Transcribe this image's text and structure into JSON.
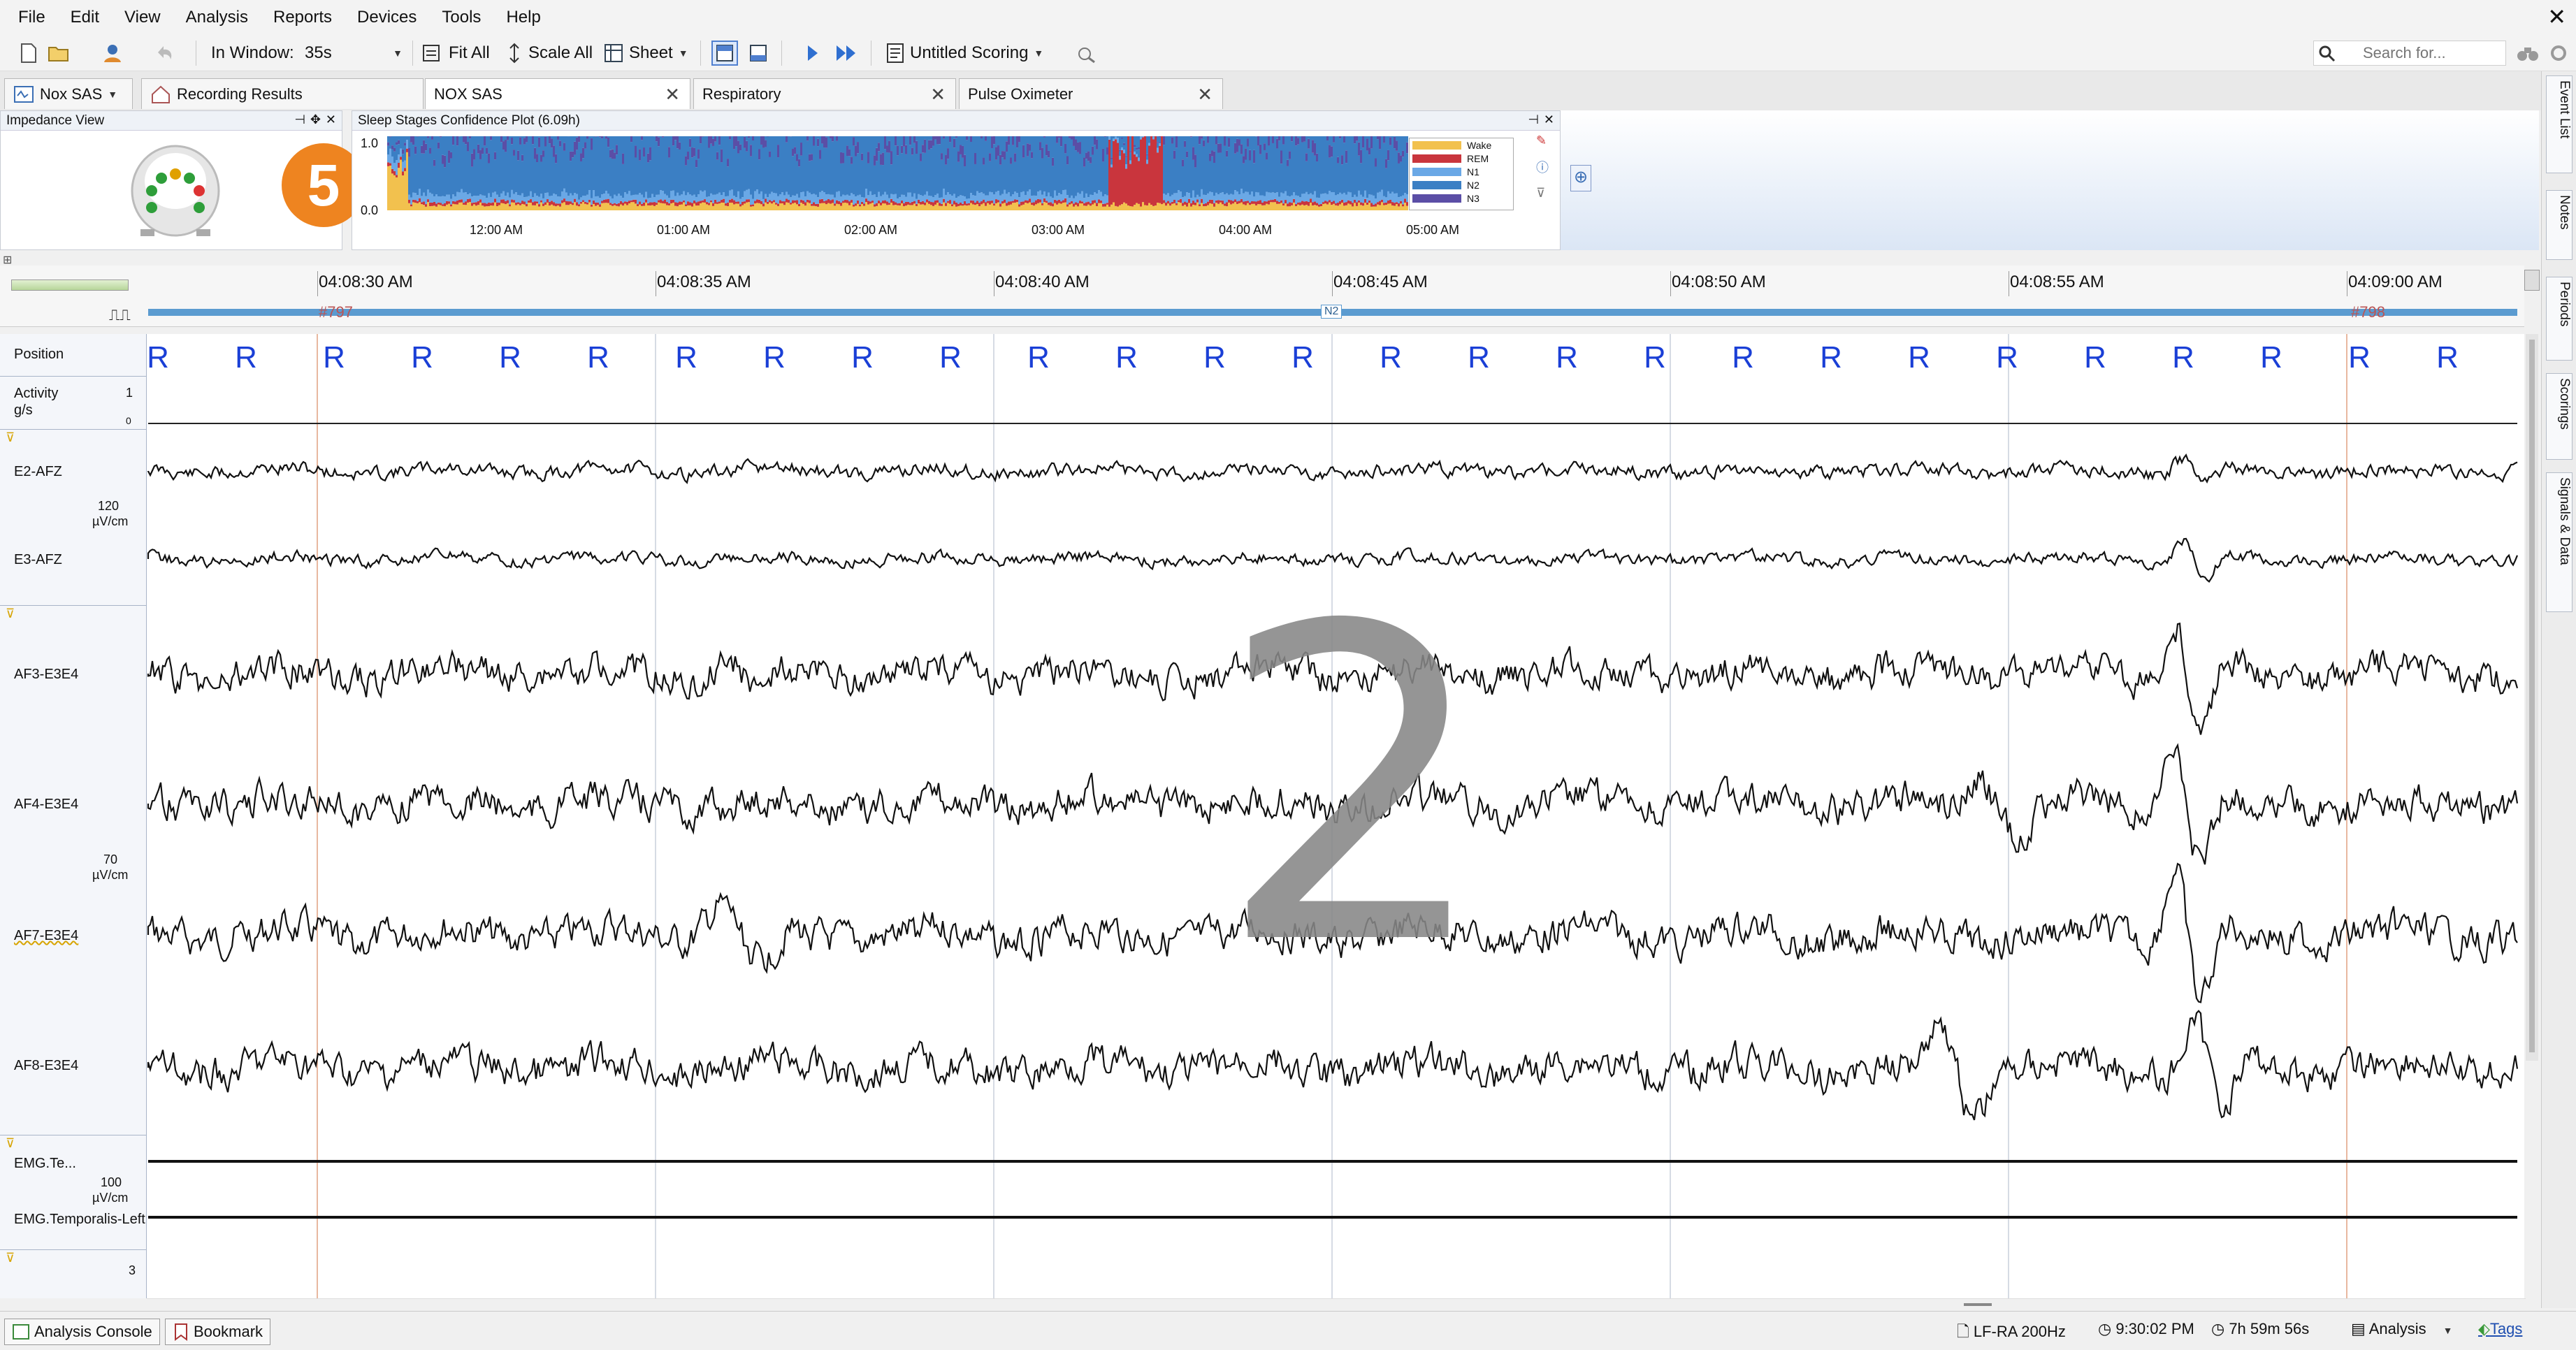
{
  "menu": [
    "File",
    "Edit",
    "View",
    "Analysis",
    "Reports",
    "Devices",
    "Tools",
    "Help"
  ],
  "toolbar": {
    "in_window_label": "In Window:",
    "in_window_value": "35s",
    "fit_all": "Fit All",
    "scale_all": "Scale All",
    "sheet": "Sheet",
    "scoring": "Untitled Scoring",
    "search_placeholder": "Search for..."
  },
  "tabs": {
    "device": "Nox SAS",
    "items": [
      "Recording Results",
      "NOX SAS",
      "Respiratory",
      "Pulse Oximeter"
    ]
  },
  "impedance": {
    "title": "Impedance View",
    "badge": "5"
  },
  "confidence": {
    "title": "Sleep Stages Confidence Plot (6.09h)",
    "ymax": "1.0",
    "ymin": "0.0",
    "times": [
      "12:00 AM",
      "01:00 AM",
      "02:00 AM",
      "03:00 AM",
      "04:00 AM",
      "05:00 AM"
    ],
    "legend": [
      {
        "name": "Wake",
        "color": "#f2c14e"
      },
      {
        "name": "REM",
        "color": "#c9353d"
      },
      {
        "name": "N1",
        "color": "#6aa8e6"
      },
      {
        "name": "N2",
        "color": "#3b7fc4"
      },
      {
        "name": "N3",
        "color": "#5b4ea6"
      }
    ]
  },
  "timeline": {
    "times": [
      "04:08:30 AM",
      "04:08:35 AM",
      "04:08:40 AM",
      "04:08:45 AM",
      "04:08:50 AM",
      "04:08:55 AM",
      "04:09:00 AM"
    ],
    "epoch_left": "#797",
    "epoch_right": "#798",
    "stage": "N2"
  },
  "position": {
    "label": "Position",
    "value": "R",
    "count": 27
  },
  "activity": {
    "label": "Activity",
    "unit": "g/s",
    "max": "1",
    "min": "0"
  },
  "channels": [
    {
      "name": "E2-AFZ"
    },
    {
      "name": "E3-AFZ"
    },
    {
      "name": "AF3-E3E4"
    },
    {
      "name": "AF4-E3E4"
    },
    {
      "name": "AF7-E3E4"
    },
    {
      "name": "AF8-E3E4"
    },
    {
      "name": "EMG.Te..."
    },
    {
      "name": "EMG.Temporalis-Left"
    }
  ],
  "scales": [
    {
      "value": "120",
      "unit": "µV/cm"
    },
    {
      "value": "70",
      "unit": "µV/cm"
    },
    {
      "value": "100",
      "unit": "µV/cm"
    }
  ],
  "bottom_scale": "3",
  "overlay_number": "2",
  "dock": [
    "Event List",
    "Notes",
    "Periods",
    "Scorings",
    "Signals & Data"
  ],
  "status": {
    "console": "Analysis Console",
    "bookmark": "Bookmark",
    "filter": "LF-RA 200Hz",
    "clock": "9:30:02 PM",
    "duration": "7h 59m 56s",
    "mode": "Analysis",
    "tags": "Tags"
  }
}
